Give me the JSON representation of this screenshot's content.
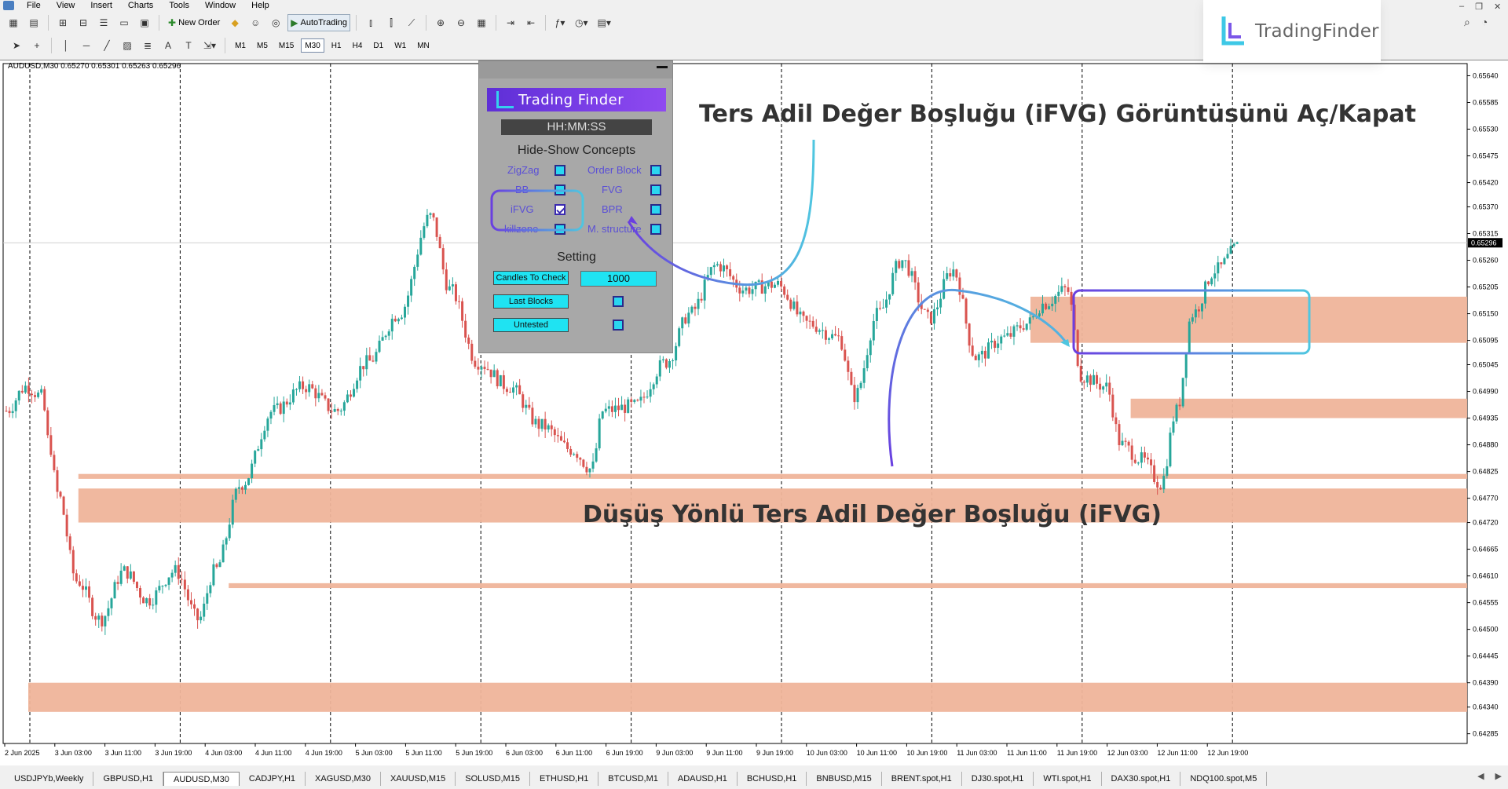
{
  "menu": [
    "File",
    "View",
    "Insert",
    "Charts",
    "Tools",
    "Window",
    "Help"
  ],
  "toolbar": {
    "new_order": "New Order",
    "autotrading": "AutoTrading"
  },
  "timeframes": [
    "M1",
    "M5",
    "M15",
    "M30",
    "H1",
    "H4",
    "D1",
    "W1",
    "MN"
  ],
  "active_timeframe": "M30",
  "brand": {
    "name": "TradingFinder"
  },
  "symbol_info": "AUDUSD,M30  0.65270 0.65301 0.65263 0.65296",
  "panel": {
    "logo_text": "Trading Finder",
    "timer": "HH:MM:SS",
    "section1": "Hide-Show Concepts",
    "options": [
      {
        "label": "ZigZag",
        "checked": false
      },
      {
        "label": "Order Block",
        "checked": false
      },
      {
        "label": "BB",
        "checked": false
      },
      {
        "label": "FVG",
        "checked": false
      },
      {
        "label": "iFVG",
        "checked": true
      },
      {
        "label": "BPR",
        "checked": false
      },
      {
        "label": "killzone",
        "checked": false
      },
      {
        "label": "M. structure",
        "checked": false
      }
    ],
    "section2": "Setting",
    "candles_label": "Candles To Check",
    "candles_value": "1000",
    "last_blocks_label": "Last Blocks",
    "untested_label": "Untested"
  },
  "annotations": {
    "top": "Ters Adil Değer Boşluğu (iFVG) Görüntüsünü Aç/Kapat",
    "bottom": "Düşüş Yönlü Ters Adil Değer Boşluğu (iFVG)"
  },
  "chart_data": {
    "type": "candlestick",
    "symbol": "AUDUSD",
    "timeframe": "M30",
    "current_price": "0.65296",
    "y_ticks": [
      "0.65640",
      "0.65585",
      "0.65530",
      "0.65475",
      "0.65420",
      "0.65370",
      "0.65315",
      "0.65260",
      "0.65205",
      "0.65150",
      "0.65095",
      "0.65045",
      "0.64990",
      "0.64935",
      "0.64880",
      "0.64825",
      "0.64770",
      "0.64720",
      "0.64665",
      "0.64610",
      "0.64555",
      "0.64500",
      "0.64445",
      "0.64390",
      "0.64340",
      "0.64285"
    ],
    "ylim": [
      0.64265,
      0.65665
    ],
    "x_ticks": [
      "2 Jun 2025",
      "3 Jun 03:00",
      "3 Jun 11:00",
      "3 Jun 19:00",
      "4 Jun 03:00",
      "4 Jun 11:00",
      "4 Jun 19:00",
      "5 Jun 03:00",
      "5 Jun 11:00",
      "5 Jun 19:00",
      "6 Jun 03:00",
      "6 Jun 11:00",
      "6 Jun 19:00",
      "9 Jun 03:00",
      "9 Jun 11:00",
      "9 Jun 19:00",
      "10 Jun 03:00",
      "10 Jun 11:00",
      "10 Jun 19:00",
      "11 Jun 03:00",
      "11 Jun 11:00",
      "11 Jun 19:00",
      "12 Jun 03:00",
      "12 Jun 11:00",
      "12 Jun 19:00"
    ],
    "zones": [
      {
        "from": 0.6481,
        "to": 0.6482,
        "start": "3 Jun 03:00"
      },
      {
        "from": 0.6472,
        "to": 0.6479,
        "start": "3 Jun 03:00"
      },
      {
        "from": 0.64585,
        "to": 0.64595,
        "start": "4 Jun 03:00"
      },
      {
        "from": 0.6433,
        "to": 0.6439,
        "start": "2 Jun 2025"
      },
      {
        "from": 0.6509,
        "to": 0.65185,
        "start": "11 Jun 11:00"
      },
      {
        "from": 0.64935,
        "to": 0.64975,
        "start": "12 Jun 03:00"
      }
    ],
    "colors": {
      "bull": "#26a69a",
      "bear": "#d9534f",
      "zone": "#efb49a",
      "highlight": "#5bc8e0"
    },
    "grid": "vertical dashed"
  },
  "tabs": [
    "USDJPYb,Weekly",
    "GBPUSD,H1",
    "AUDUSD,M30",
    "CADJPY,H1",
    "XAGUSD,M30",
    "XAUUSD,M15",
    "SOLUSD,M15",
    "ETHUSD,H1",
    "BTCUSD,M1",
    "ADAUSD,H1",
    "BCHUSD,H1",
    "BNBUSD,M15",
    "BRENT.spot,H1",
    "DJ30.spot,H1",
    "WTI.spot,H1",
    "DAX30.spot,H1",
    "NDQ100.spot,M5"
  ],
  "active_tab": "AUDUSD,M30"
}
